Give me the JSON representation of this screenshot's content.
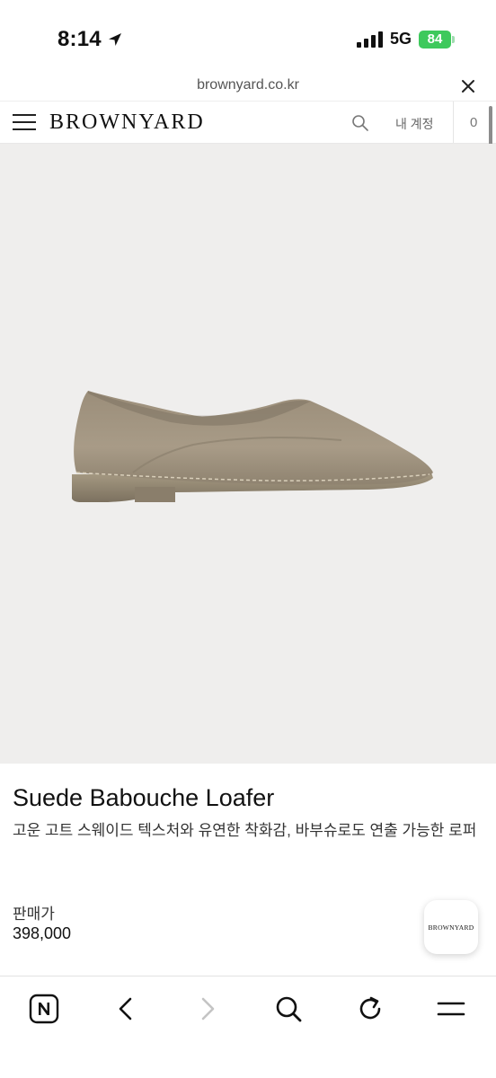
{
  "status_bar": {
    "time": "8:14",
    "network": "5G",
    "battery": "84"
  },
  "browser": {
    "url": "brownyard.co.kr"
  },
  "header": {
    "brand": "BROWNYARD",
    "account_label": "내 계정",
    "cart_count": "0"
  },
  "product": {
    "name": "Suede Babouche Loafer",
    "description": "고운 고트 스웨이드 텍스처와 유연한 착화감, 바부슈로도 연출 가능한 로퍼",
    "price_label": "판매가",
    "price": "398,000"
  },
  "floating_badge": {
    "brand": "BROWNYARD"
  },
  "toolbar": {
    "icons": [
      "naver-n-icon",
      "back-arrow-icon",
      "forward-arrow-icon",
      "search-icon",
      "refresh-icon",
      "menu-icon"
    ]
  },
  "colors": {
    "image_background": "#efeeed",
    "suede": "#a39682",
    "battery_green": "#3ec95c"
  }
}
